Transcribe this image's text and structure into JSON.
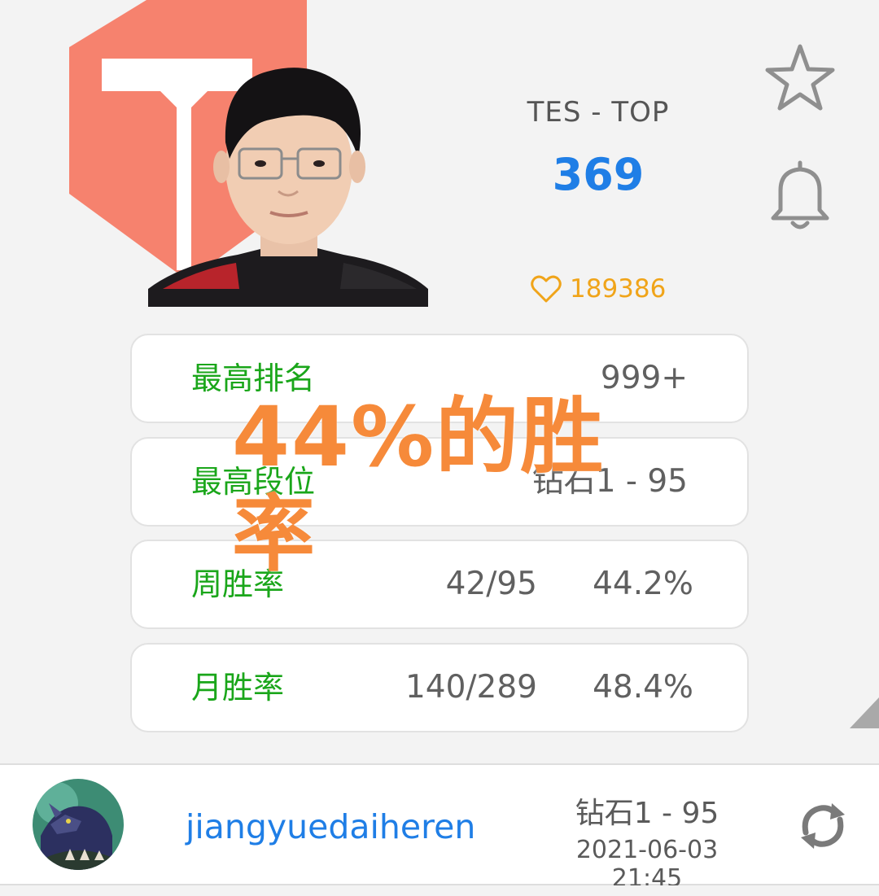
{
  "player": {
    "team_position": "TES - TOP",
    "score": "369",
    "likes": "189386"
  },
  "stats": [
    {
      "label": "最高排名",
      "value": "999+"
    },
    {
      "label": "最高段位",
      "value": "钻石1 - 95"
    },
    {
      "label": "周胜率",
      "record": "42/95",
      "rate": "44.2%"
    },
    {
      "label": "月胜率",
      "record": "140/289",
      "rate": "48.4%"
    }
  ],
  "overlay": {
    "caption": "44%的胜率"
  },
  "account": {
    "username": "jiangyuedaiheren",
    "rank": "钻石1 - 95",
    "timestamp": "2021-06-03 21:45"
  },
  "colors": {
    "accent_blue": "#1f7ee6",
    "label_green": "#1aa61a",
    "like_orange": "#f0a419",
    "logo_salmon": "#f6826e",
    "caption_orange": "#f68a3a"
  },
  "icons": {
    "favorite": "star-icon",
    "notify": "bell-icon",
    "like": "heart-icon",
    "refresh": "refresh-icon"
  }
}
